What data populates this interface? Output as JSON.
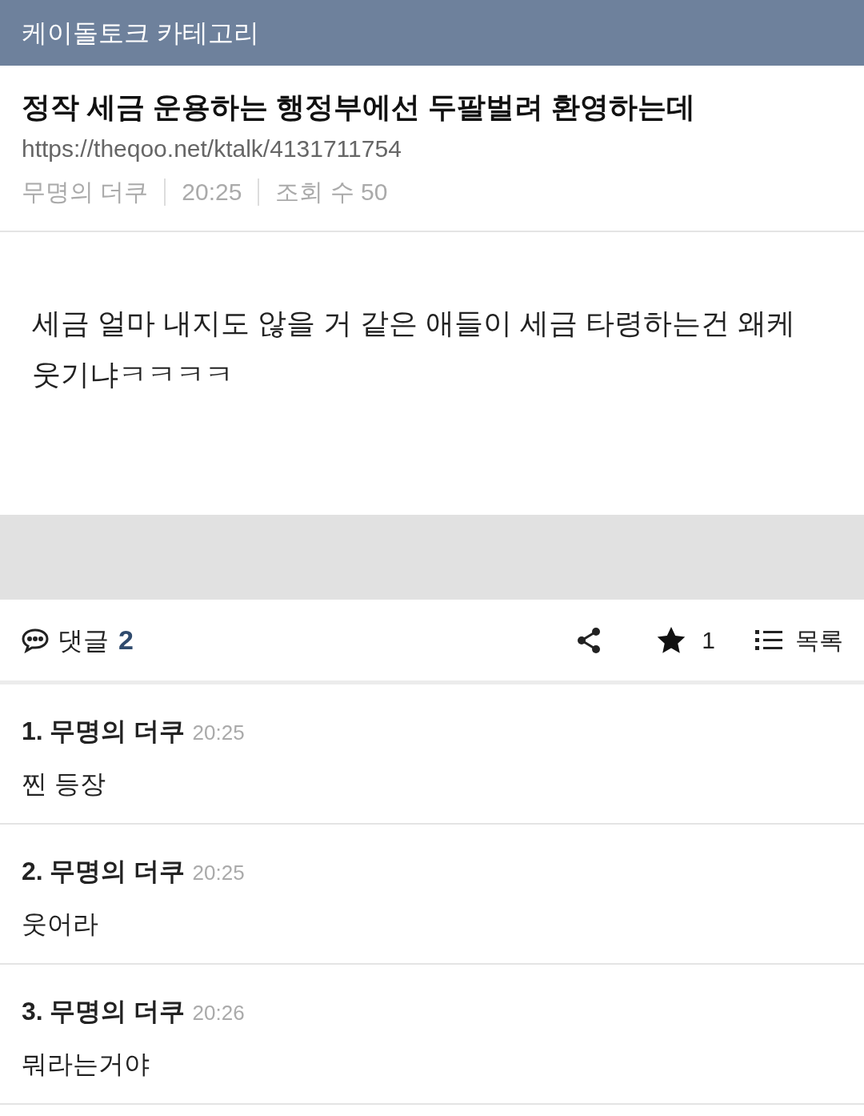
{
  "header": {
    "title": "케이돌토크 카테고리"
  },
  "post": {
    "title": "정작 세금 운용하는 행정부에선 두팔벌려 환영하는데",
    "url": "https://theqoo.net/ktalk/4131711754",
    "meta": [
      "무명의 더쿠",
      "20:25",
      "조회 수 50"
    ],
    "body": "세금 얼마 내지도 않을 거 같은 애들이 세금 타령하는건 왜케 웃기냐ㅋㅋㅋㅋ"
  },
  "actions": {
    "comments_label": "댓글",
    "comments_count": "2",
    "star_count": "1",
    "list_label": "목록"
  },
  "comments": [
    {
      "number": "1.",
      "author": "무명의 더쿠",
      "time": "20:25",
      "text": "찐 등장"
    },
    {
      "number": "2.",
      "author": "무명의 더쿠",
      "time": "20:25",
      "text": "웃어라"
    },
    {
      "number": "3.",
      "author": "무명의 더쿠",
      "time": "20:26",
      "text": "뭐라는거야"
    }
  ]
}
